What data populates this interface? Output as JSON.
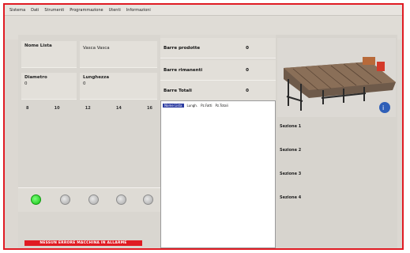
{
  "menu": [
    "Sistema",
    "Dati",
    "Strumenti",
    "Programmazione",
    "Utenti",
    "Informazioni"
  ],
  "fields": {
    "nome_lista": {
      "label": "Nome Lista",
      "value": "Vasca Vasca"
    },
    "diametro": {
      "label": "Diametro",
      "value": "0"
    },
    "lunghezza": {
      "label": "Lunghezza",
      "value": "0"
    }
  },
  "scale_numbers": [
    "8",
    "10",
    "12",
    "14",
    "16"
  ],
  "counters": [
    {
      "label": "Barre prodotte",
      "value": "0"
    },
    {
      "label": "Barre rimanenti",
      "value": "0"
    },
    {
      "label": "Barre Totali",
      "value": "0"
    }
  ],
  "list_columns": [
    {
      "label": "Nome Lista",
      "selected": true
    },
    {
      "label": "Lungh.",
      "selected": false
    },
    {
      "label": "Pz.Fatti",
      "selected": false
    },
    {
      "label": "Pz.Totali",
      "selected": false
    }
  ],
  "leds": [
    {
      "name": "led-1",
      "on": true
    },
    {
      "name": "led-2",
      "on": false
    },
    {
      "name": "led-3",
      "on": false
    },
    {
      "name": "led-4",
      "on": false
    },
    {
      "name": "led-5",
      "on": false
    }
  ],
  "sections": [
    "Sezione 1",
    "Sezione 2",
    "Sezione 3",
    "Sezione 4"
  ],
  "alarm_text": "NESSUN ERRORE MACCHINA IN ALLARME",
  "colors": {
    "alarm": "#e01b23",
    "led_on": "#12c012",
    "frame_border": "#e01b23"
  }
}
